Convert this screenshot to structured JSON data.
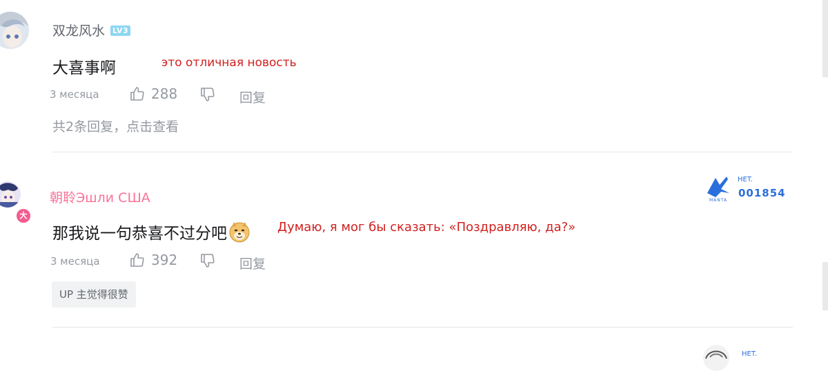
{
  "comments": [
    {
      "username": "双龙风水",
      "level": "LV3",
      "content": "大喜事啊",
      "translation": "это отличная новость",
      "time": "3 месяца",
      "likes": "288",
      "reply_label": "回复",
      "sub_replies": "共2条回复，点击查看"
    },
    {
      "username": "朝聆Эшли США",
      "avatar_badge": "大",
      "content": "那我说一句恭喜不过分吧",
      "emoji": "doge-emoji",
      "translation": "Думаю, я мог бы сказать: «Поздравляю, да?»",
      "time": "3 месяца",
      "likes": "392",
      "reply_label": "回复",
      "up_tag": "UP 主觉得很赞",
      "fan_badge": {
        "small": "HET.",
        "number": "001854",
        "brand": "MANTA"
      }
    }
  ],
  "partial_next": {
    "badge_small": "HET."
  },
  "colors": {
    "username_pink": "#fb7299",
    "translation_red": "#d0201f",
    "level_blue": "#8cd6f2",
    "badge_blue": "#2a6fdb"
  },
  "icons": [
    "thumbs-up-icon",
    "thumbs-down-icon",
    "doge-emoji",
    "manta-logo-icon"
  ]
}
